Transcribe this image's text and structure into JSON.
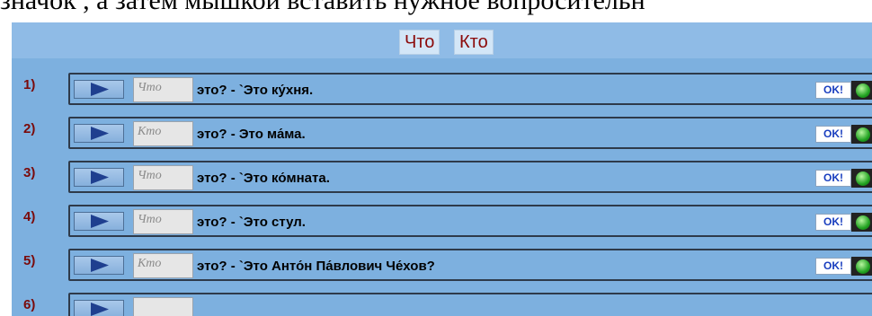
{
  "instruction_text": "значок , а затем мышкой вставить нужное вопросительн",
  "word_bank": [
    "Что",
    "Кто"
  ],
  "ok_label": "OK!",
  "rows": [
    {
      "number": "1)",
      "answer": "Что",
      "sentence": "это? - `Это ку́хня."
    },
    {
      "number": "2)",
      "answer": "Кто",
      "sentence": "это? - Это ма́ма."
    },
    {
      "number": "3)",
      "answer": "Что",
      "sentence": "это? - `Это ко́мната."
    },
    {
      "number": "4)",
      "answer": "Что",
      "sentence": "это? - `Это стул."
    },
    {
      "number": "5)",
      "answer": "Кто",
      "sentence": "это? - `Это Анто́н Па́влович Че́хов?"
    },
    {
      "number": "6)",
      "answer": "",
      "sentence": ""
    }
  ]
}
